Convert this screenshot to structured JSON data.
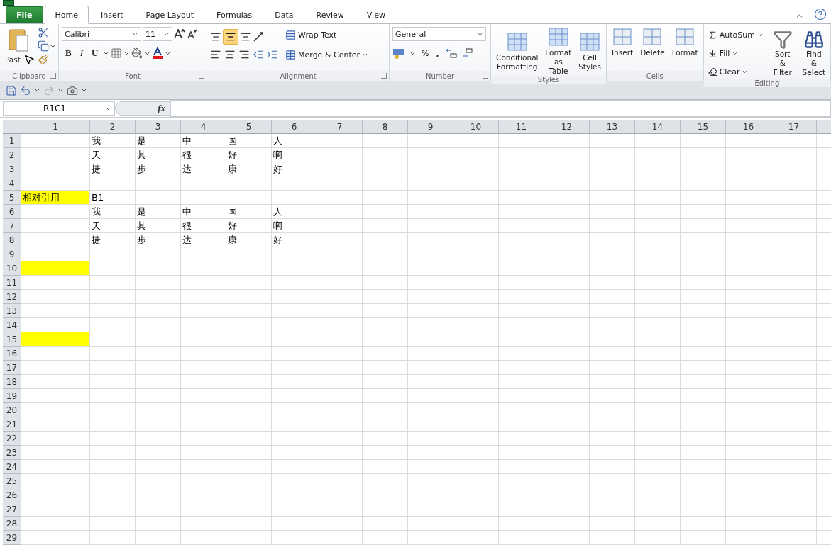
{
  "ribbon": {
    "tabs": [
      {
        "label": "File",
        "kind": "file",
        "selected": false
      },
      {
        "label": "Home",
        "kind": "tab",
        "selected": true
      },
      {
        "label": "Insert",
        "kind": "tab",
        "selected": false
      },
      {
        "label": "Page Layout",
        "kind": "tab",
        "selected": false
      },
      {
        "label": "Formulas",
        "kind": "tab",
        "selected": false
      },
      {
        "label": "Data",
        "kind": "tab",
        "selected": false
      },
      {
        "label": "Review",
        "kind": "tab",
        "selected": false
      },
      {
        "label": "View",
        "kind": "tab",
        "selected": false
      }
    ],
    "groups": [
      {
        "kind": "clipboard",
        "label": "Clipboard",
        "paste": "Past",
        "launcher": true
      },
      {
        "kind": "font",
        "label": "Font",
        "font_name": "Calibri",
        "font_size": "11",
        "bold": "B",
        "italic": "I",
        "underline": "U",
        "launcher": true
      },
      {
        "kind": "alignment",
        "label": "Alignment",
        "wrap_text": "Wrap Text",
        "merge_center": "Merge & Center",
        "middle_align_selected": true,
        "launcher": true
      },
      {
        "kind": "number",
        "label": "Number",
        "format": "General",
        "percent": "%",
        "comma": ",",
        "launcher": true
      },
      {
        "kind": "styles",
        "label": "Styles",
        "buttons": [
          {
            "lines": [
              "Conditional",
              "Formatting"
            ]
          },
          {
            "lines": [
              "Format",
              "as Table"
            ]
          },
          {
            "lines": [
              "Cell",
              "Styles"
            ]
          }
        ]
      },
      {
        "kind": "cells",
        "label": "Cells",
        "buttons": [
          {
            "lines": [
              "Insert"
            ]
          },
          {
            "lines": [
              "Delete"
            ]
          },
          {
            "lines": [
              "Format"
            ]
          }
        ]
      },
      {
        "kind": "editing",
        "label": "Editing",
        "small": [
          "AutoSum",
          "Fill",
          "Clear"
        ],
        "buttons": [
          {
            "lines": [
              "Sort &",
              "Filter"
            ]
          },
          {
            "lines": [
              "Find &",
              "Select"
            ]
          }
        ]
      }
    ]
  },
  "formula_bar": {
    "name_box": "R1C1",
    "fx": "fx"
  },
  "sheet": {
    "columns": [
      "1",
      "2",
      "3",
      "4",
      "5",
      "6",
      "7",
      "8",
      "9",
      "10",
      "11",
      "12",
      "13",
      "14",
      "15",
      "16",
      "17"
    ],
    "rows": [
      {
        "number": "1",
        "cells": [
          {
            "highlighted": false
          },
          {
            "text": "我",
            "highlighted": false
          },
          {
            "text": "是",
            "highlighted": false
          },
          {
            "text": "中",
            "highlighted": false
          },
          {
            "text": "国",
            "highlighted": false
          },
          {
            "text": "人",
            "highlighted": false
          }
        ]
      },
      {
        "number": "2",
        "cells": [
          {
            "highlighted": false
          },
          {
            "text": "天",
            "highlighted": false
          },
          {
            "text": "其",
            "highlighted": false
          },
          {
            "text": "很",
            "highlighted": false
          },
          {
            "text": "好",
            "highlighted": false
          },
          {
            "text": "啊",
            "highlighted": false
          }
        ]
      },
      {
        "number": "3",
        "cells": [
          {
            "highlighted": false
          },
          {
            "text": "捷",
            "highlighted": false
          },
          {
            "text": "步",
            "highlighted": false
          },
          {
            "text": "达",
            "highlighted": false
          },
          {
            "text": "康",
            "highlighted": false
          },
          {
            "text": "好",
            "highlighted": false
          }
        ]
      },
      {
        "number": "4",
        "cells": []
      },
      {
        "number": "5",
        "cells": [
          {
            "text": "相对引用",
            "highlighted": true
          },
          {
            "text": "B1",
            "highlighted": false
          }
        ]
      },
      {
        "number": "6",
        "cells": [
          {
            "highlighted": false
          },
          {
            "text": "我",
            "highlighted": false
          },
          {
            "text": "是",
            "highlighted": false
          },
          {
            "text": "中",
            "highlighted": false
          },
          {
            "text": "国",
            "highlighted": false
          },
          {
            "text": "人",
            "highlighted": false
          }
        ]
      },
      {
        "number": "7",
        "cells": [
          {
            "highlighted": false
          },
          {
            "text": "天",
            "highlighted": false
          },
          {
            "text": "其",
            "highlighted": false
          },
          {
            "text": "很",
            "highlighted": false
          },
          {
            "text": "好",
            "highlighted": false
          },
          {
            "text": "啊",
            "highlighted": false
          }
        ]
      },
      {
        "number": "8",
        "cells": [
          {
            "highlighted": false
          },
          {
            "text": "捷",
            "highlighted": false
          },
          {
            "text": "步",
            "highlighted": false
          },
          {
            "text": "达",
            "highlighted": false
          },
          {
            "text": "康",
            "highlighted": false
          },
          {
            "text": "好",
            "highlighted": false
          }
        ]
      },
      {
        "number": "9",
        "cells": []
      },
      {
        "number": "10",
        "cells": [
          {
            "highlighted": true
          }
        ]
      },
      {
        "number": "11",
        "cells": []
      },
      {
        "number": "12",
        "cells": []
      },
      {
        "number": "13",
        "cells": []
      },
      {
        "number": "14",
        "cells": []
      },
      {
        "number": "15",
        "cells": [
          {
            "highlighted": true
          }
        ]
      },
      {
        "number": "16",
        "cells": []
      },
      {
        "number": "17",
        "cells": []
      },
      {
        "number": "18",
        "cells": []
      },
      {
        "number": "19",
        "cells": []
      },
      {
        "number": "20",
        "cells": []
      },
      {
        "number": "21",
        "cells": []
      },
      {
        "number": "22",
        "cells": []
      },
      {
        "number": "23",
        "cells": []
      },
      {
        "number": "24",
        "cells": []
      },
      {
        "number": "25",
        "cells": []
      },
      {
        "number": "26",
        "cells": []
      },
      {
        "number": "27",
        "cells": []
      },
      {
        "number": "28",
        "cells": []
      },
      {
        "number": "29",
        "cells": []
      }
    ]
  }
}
